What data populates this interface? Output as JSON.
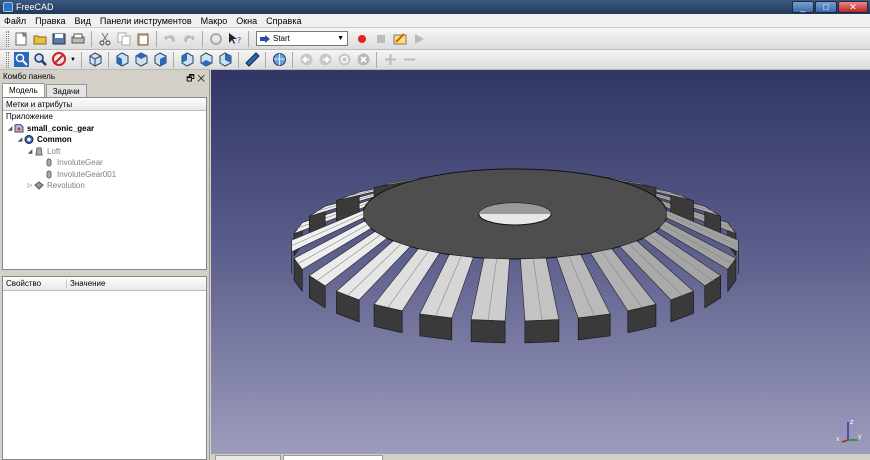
{
  "window": {
    "title": "FreeCAD",
    "minimize": "_",
    "maximize": "□",
    "close": "✕"
  },
  "menu": [
    "Файл",
    "Правка",
    "Вид",
    "Панели инструментов",
    "Макро",
    "Окна",
    "Справка"
  ],
  "toolbar": {
    "workbench": "Start"
  },
  "panel": {
    "title": "Комбо панель",
    "controls": "🗗 ✕",
    "tabs": [
      "Модель",
      "Задачи"
    ],
    "tree_header": "Метки и атрибуты",
    "tree": [
      {
        "label": "Приложение",
        "indent": 0,
        "style": ""
      },
      {
        "label": "small_conic_gear",
        "indent": 1,
        "style": "bold"
      },
      {
        "label": "Common",
        "indent": 2,
        "style": "bold"
      },
      {
        "label": "Loft",
        "indent": 3,
        "style": "grey"
      },
      {
        "label": "InvoluteGear",
        "indent": 4,
        "style": "grey"
      },
      {
        "label": "InvoluteGear001",
        "indent": 4,
        "style": "grey"
      },
      {
        "label": "Revolution",
        "indent": 3,
        "style": "grey"
      }
    ],
    "props_headers": [
      "Свойство",
      "Значение"
    ]
  },
  "axis": {
    "z": "z",
    "x": "x",
    "y": "y"
  },
  "colors": {
    "bg_top": "#313664",
    "bg_bottom": "#9c9cbc",
    "gear_top": "#4e4e4e",
    "tooth_light": "#e6e6e6",
    "tooth_dark": "#3a3a3a"
  }
}
